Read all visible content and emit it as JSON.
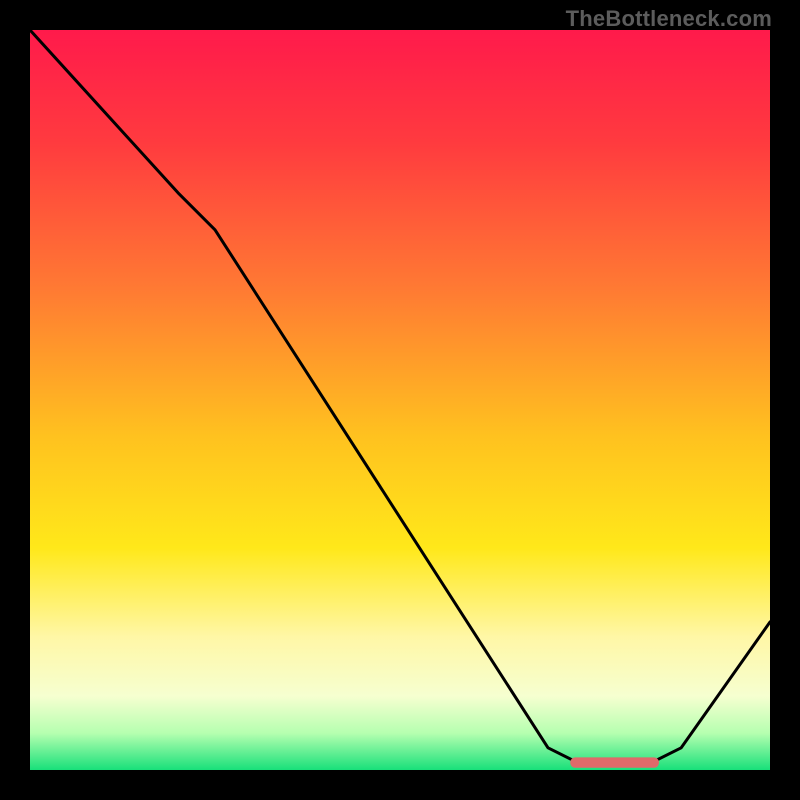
{
  "watermark": "TheBottleneck.com",
  "chart_data": {
    "type": "line",
    "title": "",
    "xlabel": "",
    "ylabel": "",
    "xlim": [
      0,
      100
    ],
    "ylim": [
      0,
      100
    ],
    "gradient_stops": [
      {
        "pct": 0,
        "color": "#ff1a4b"
      },
      {
        "pct": 15,
        "color": "#ff3a3f"
      },
      {
        "pct": 35,
        "color": "#ff7a33"
      },
      {
        "pct": 55,
        "color": "#ffc21f"
      },
      {
        "pct": 70,
        "color": "#ffe81a"
      },
      {
        "pct": 82,
        "color": "#fff7a6"
      },
      {
        "pct": 90,
        "color": "#f6ffd0"
      },
      {
        "pct": 95,
        "color": "#b6ffb0"
      },
      {
        "pct": 100,
        "color": "#18e07a"
      }
    ],
    "series": [
      {
        "name": "curve",
        "note": "y is distance above bottom of plot (0..100)",
        "points": [
          {
            "x": 0,
            "y": 100
          },
          {
            "x": 20,
            "y": 78
          },
          {
            "x": 25,
            "y": 73
          },
          {
            "x": 70,
            "y": 3
          },
          {
            "x": 74,
            "y": 1
          },
          {
            "x": 84,
            "y": 1
          },
          {
            "x": 88,
            "y": 3
          },
          {
            "x": 100,
            "y": 20
          }
        ]
      }
    ],
    "marker": {
      "name": "optimal-range",
      "color": "#e06a6a",
      "y": 1,
      "x_start": 73,
      "x_end": 85,
      "thickness_pct": 1.4
    }
  }
}
